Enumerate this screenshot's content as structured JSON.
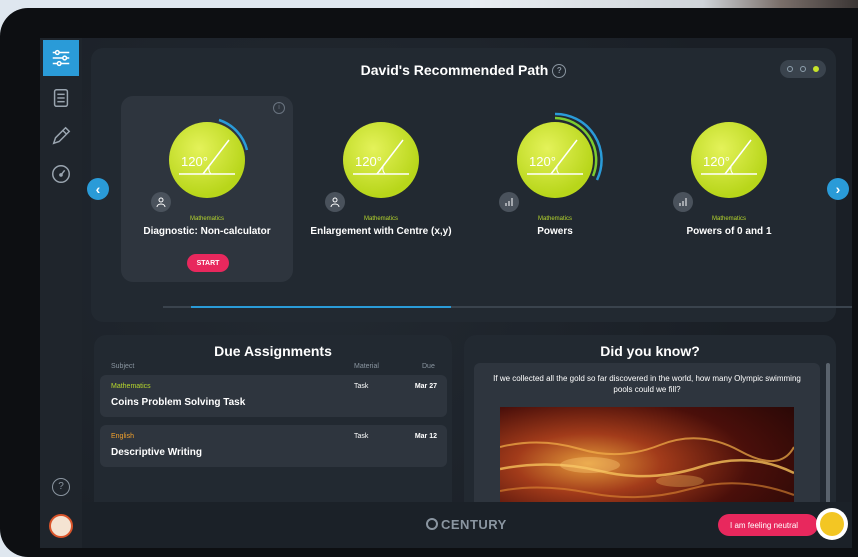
{
  "header": {
    "title": "David's Recommended Path",
    "help_icon": "?"
  },
  "sidebar": {
    "items": [
      {
        "icon": "sliders-icon",
        "active": true
      },
      {
        "icon": "notebook-icon",
        "active": false
      },
      {
        "icon": "pencil-icon",
        "active": false
      },
      {
        "icon": "speedometer-icon",
        "active": false
      }
    ],
    "help_label": "?"
  },
  "path": {
    "cards": [
      {
        "angle": "120°",
        "subject": "Mathematics",
        "title": "Diagnostic: Non-calculator",
        "button": "START",
        "selected": true
      },
      {
        "angle": "120°",
        "subject": "Mathematics",
        "title": "Enlargement with Centre (x,y)",
        "selected": false
      },
      {
        "angle": "120°",
        "subject": "Mathematics",
        "title": "Powers",
        "selected": false
      },
      {
        "angle": "120°",
        "subject": "Mathematics",
        "title": "Powers of 0 and 1",
        "selected": false
      }
    ],
    "progress": 0.37
  },
  "assignments": {
    "title": "Due Assignments",
    "columns": {
      "subject": "Subject",
      "material": "Material",
      "due": "Due"
    },
    "rows": [
      {
        "subject": "Mathematics",
        "subject_color": "#b6d72d",
        "title": "Coins Problem Solving Task",
        "material": "Task",
        "due": "Mar 27"
      },
      {
        "subject": "English",
        "subject_color": "#f2a12c",
        "title": "Descriptive Writing",
        "material": "Task",
        "due": "Mar 12"
      }
    ]
  },
  "did_you_know": {
    "title": "Did you know?",
    "text": "If we collected all the gold so far discovered in the world, how many Olympic swimming pools could we fill?"
  },
  "footer": {
    "logo": "CENTURY",
    "mood_label": "I am feeling neutral"
  },
  "colors": {
    "accent": "#2a9bd8",
    "brand_pink": "#e8285d",
    "lime": "#b6d72d"
  }
}
